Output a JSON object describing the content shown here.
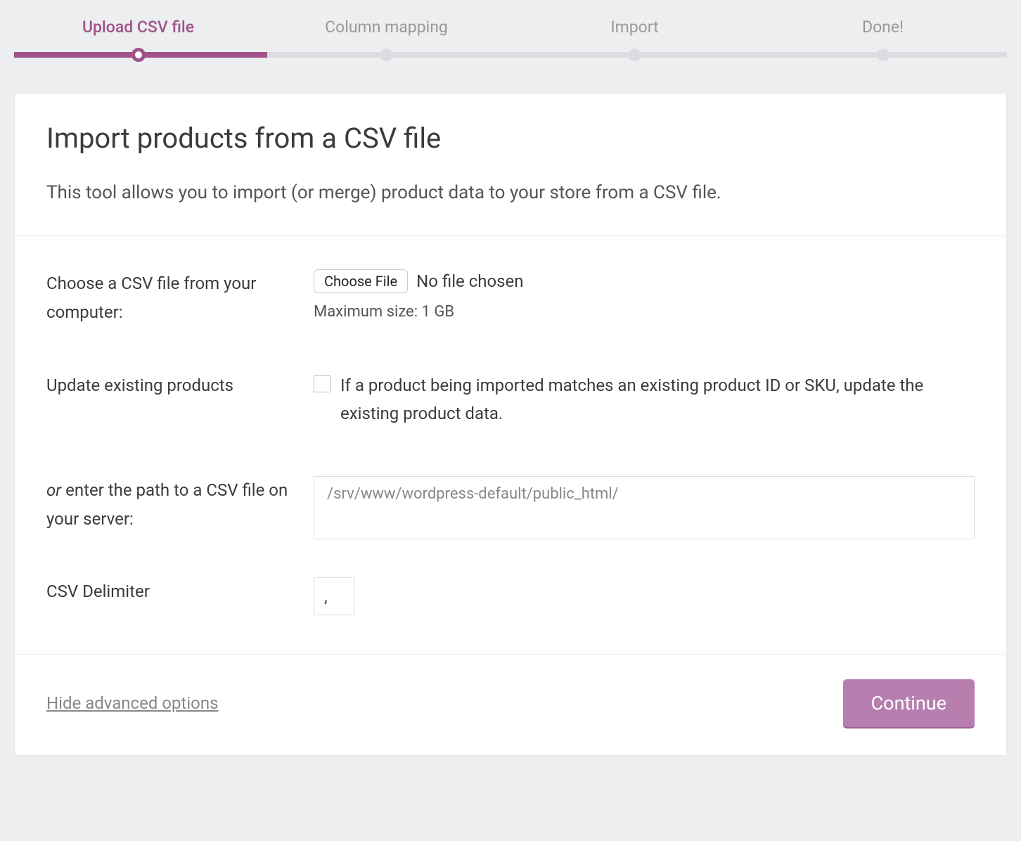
{
  "steps": {
    "items": [
      "Upload CSV file",
      "Column mapping",
      "Import",
      "Done!"
    ],
    "active_index": 0
  },
  "header": {
    "title": "Import products from a CSV file",
    "description": "This tool allows you to import (or merge) product data to your store from a CSV file."
  },
  "fields": {
    "choose_file": {
      "label": "Choose a CSV file from your computer:",
      "button_label": "Choose File",
      "status": "No file chosen",
      "hint": "Maximum size: 1 GB"
    },
    "update_existing": {
      "label": "Update existing products",
      "description": "If a product being imported matches an existing product ID or SKU, update the existing product data.",
      "checked": false
    },
    "server_path": {
      "label_prefix": "or",
      "label_rest": " enter the path to a CSV file on your server:",
      "placeholder": "/srv/www/wordpress-default/public_html/",
      "value": ""
    },
    "delimiter": {
      "label": "CSV Delimiter",
      "value": ","
    }
  },
  "footer": {
    "advanced_link": "Hide advanced options",
    "continue_button": "Continue"
  },
  "colors": {
    "accent": "#a0538a",
    "button": "#b77fb0"
  }
}
